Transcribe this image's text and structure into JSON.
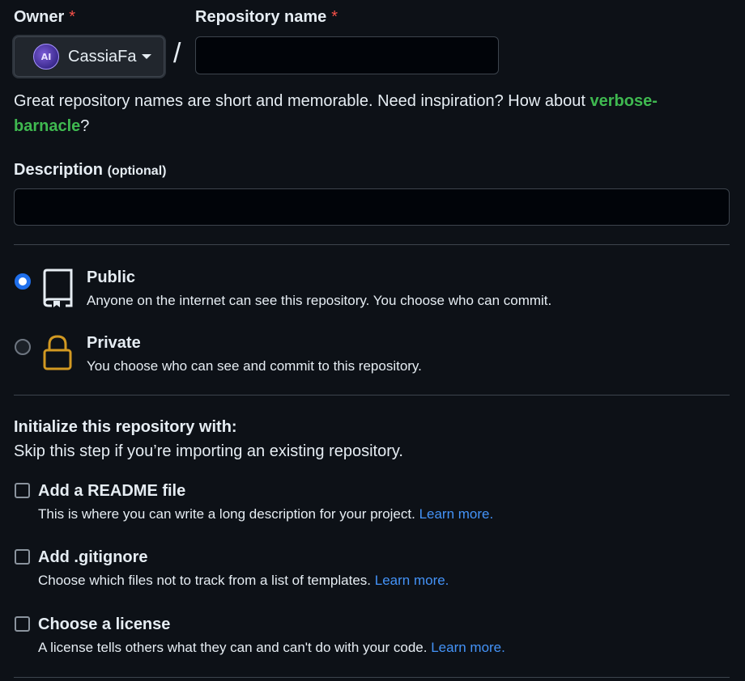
{
  "owner": {
    "label": "Owner",
    "required_mark": "*",
    "selected": "CassiaFa",
    "avatar_text": "AI"
  },
  "repo_name": {
    "label": "Repository name",
    "required_mark": "*",
    "value": "",
    "separator": "/"
  },
  "name_hint": {
    "text": "Great repository names are short and memorable. Need inspiration? How about ",
    "suggestion": "verbose-barnacle",
    "suffix": "?"
  },
  "description": {
    "label": "Description",
    "optional": "(optional)",
    "value": ""
  },
  "visibility": {
    "options": [
      {
        "title": "Public",
        "description": "Anyone on the internet can see this repository. You choose who can commit.",
        "checked": true
      },
      {
        "title": "Private",
        "description": "You choose who can see and commit to this repository.",
        "checked": false
      }
    ]
  },
  "initialize": {
    "title": "Initialize this repository with:",
    "subtitle": "Skip this step if you’re importing an existing repository.",
    "items": [
      {
        "title": "Add a README file",
        "description": "This is where you can write a long description for your project.",
        "link": "Learn more.",
        "checked": false
      },
      {
        "title": "Add .gitignore",
        "description": "Choose which files not to track from a list of templates.",
        "link": "Learn more.",
        "checked": false
      },
      {
        "title": "Choose a license",
        "description": "A license tells others what they can and can't do with your code.",
        "link": "Learn more.",
        "checked": false
      }
    ]
  },
  "colors": {
    "background": "#0d1117",
    "accent_blue": "#1f6feb",
    "link": "#4493f8",
    "suggestion_green": "#3fb950",
    "required_red": "#f85149",
    "lock_icon": "#d29922"
  },
  "icons": {
    "public": "repo-icon",
    "private": "lock-icon",
    "owner_menu": "caret-down-icon"
  }
}
